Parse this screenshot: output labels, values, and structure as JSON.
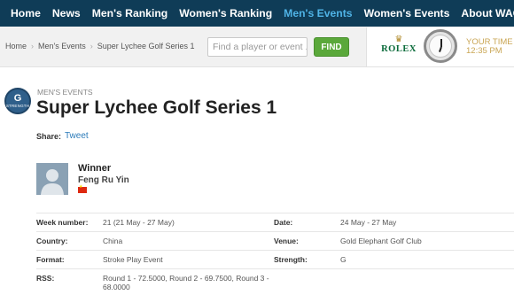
{
  "nav": {
    "items": [
      "Home",
      "News",
      "Men's Ranking",
      "Women's Ranking",
      "Men's Events",
      "Women's Events",
      "About WAGR™"
    ],
    "active_index": 4
  },
  "breadcrumb": [
    "Home",
    "Men's Events",
    "Super Lychee Golf Series 1"
  ],
  "search": {
    "placeholder": "Find a player or event ...",
    "button_label": "FIND"
  },
  "ad": {
    "brand": "ROLEX",
    "tagline": "YOUR TIME",
    "time": "12:35 PM"
  },
  "event": {
    "badge_letter": "G",
    "badge_caption": "STRENGTH",
    "category": "MEN'S EVENTS",
    "title": "Super Lychee Golf Series 1"
  },
  "share": {
    "label": "Share:",
    "tweet": "Tweet"
  },
  "winner": {
    "label": "Winner",
    "name": "Feng Ru Yin",
    "flag_country": "China"
  },
  "details": {
    "week_number_label": "Week number:",
    "week_number": "21 (21 May - 27 May)",
    "date_label": "Date:",
    "date": "24 May - 27 May",
    "country_label": "Country:",
    "country": "China",
    "venue_label": "Venue:",
    "venue": "Gold Elephant Golf Club",
    "format_label": "Format:",
    "format": "Stroke Play Event",
    "strength_label": "Strength:",
    "strength": "G",
    "rss_label": "RSS:",
    "rss": "Round 1 - 72.5000, Round 2 - 69.7500, Round 3 - 68.0000"
  },
  "colors": {
    "nav_bg": "#0f3c57",
    "active": "#4fb3e6",
    "find": "#5aa83a",
    "link": "#2b7bb9"
  }
}
